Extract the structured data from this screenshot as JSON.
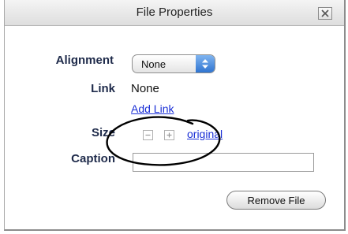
{
  "dialog": {
    "title": "File Properties",
    "close_icon": "close-icon"
  },
  "alignment": {
    "label": "Alignment",
    "selected": "None",
    "arrows_icon": "up-down-arrows-icon"
  },
  "link": {
    "label": "Link",
    "value": "None",
    "add_link": "Add Link"
  },
  "size": {
    "label": "Size",
    "decrease_icon": "minus-box-icon",
    "increase_icon": "plus-box-icon",
    "original_link": "original"
  },
  "caption": {
    "label": "Caption",
    "value": ""
  },
  "buttons": {
    "remove_file": "Remove File"
  },
  "colors": {
    "label_text": "#1e2a4a",
    "link_text": "#1a2fd6",
    "select_arrow_bg": "#2f74d0"
  }
}
